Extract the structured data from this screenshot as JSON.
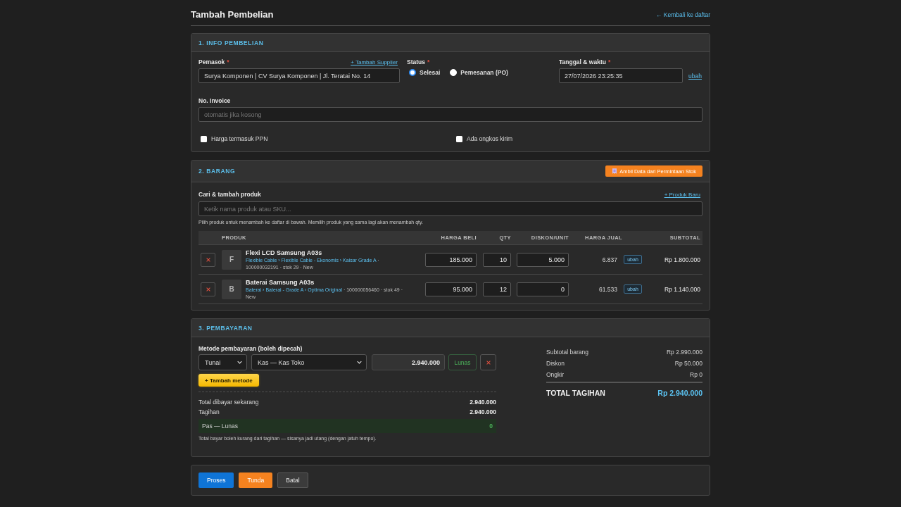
{
  "page": {
    "title": "Tambah Pembelian",
    "back_link": "← Kembali ke daftar"
  },
  "info_section": {
    "heading": "1. INFO PEMBELIAN",
    "supplier": {
      "label": "Pemasok",
      "required_mark": "*",
      "add_link": "+ Tambah Supplier",
      "value": "Surya Komponen | CV Surya Komponen | Jl. Teratai No. 14"
    },
    "status": {
      "label": "Status",
      "required_mark": "*",
      "options": [
        {
          "label": "Selesai",
          "selected": true
        },
        {
          "label": "Pemesanan (PO)",
          "selected": false
        }
      ]
    },
    "datetime": {
      "label": "Tanggal & waktu",
      "required_mark": "*",
      "value": "27/07/2026 23:25:35",
      "edit_link": "ubah"
    },
    "invoice": {
      "label": "No. Invoice",
      "placeholder": "otomatis jika kosong"
    },
    "checkboxes": [
      {
        "label": "Harga termasuk PPN",
        "checked": false
      },
      {
        "label": "Ada ongkos kirim",
        "checked": false
      }
    ]
  },
  "items_section": {
    "heading": "2. BARANG",
    "import_button": "Ambil Data dari Permintaan Stok",
    "search_label": "Cari & tambah produk",
    "new_product_link": "+ Produk Baru",
    "search": {
      "placeholder": "Ketik nama produk atau SKU..."
    },
    "hint": "Pilih produk untuk menambah ke daftar di bawah. Memilih produk yang sama lagi akan menambah qty.",
    "table": {
      "columns": [
        "PRODUK",
        "HARGA BELI",
        "QTY",
        "DISKON/UNIT",
        "HARGA JUAL",
        "SUBTOTAL"
      ],
      "rows": [
        {
          "initial": "F",
          "name": "Flexi LCD Samsung A03s",
          "category": "Flexible Cable › Flexible Cable - Ekonomis › Kaisar Grade A",
          "details": "· 100000032191 · stok 29 · New",
          "buy_price": "185.000",
          "qty": "10",
          "discount": "5.000",
          "sell_price": "6.837",
          "edit": "ubah",
          "subtotal": "Rp 1.800.000"
        },
        {
          "initial": "B",
          "name": "Baterai Samsung A03s",
          "category": "Baterai › Baterai - Grade A › Optima Original",
          "details": "· 100000056460 · stok 49 · New",
          "buy_price": "95.000",
          "qty": "12",
          "discount": "0",
          "sell_price": "61.533",
          "edit": "ubah",
          "subtotal": "Rp 1.140.000"
        }
      ]
    }
  },
  "payment_section": {
    "heading": "3. PEMBAYARAN",
    "methods_label": "Metode pembayaran (boleh dipecah)",
    "methods": [
      {
        "type": "Tunai",
        "account": "Kas — Kas Toko",
        "amount": "2.940.000",
        "pay_full": "Lunas"
      }
    ],
    "add_method": "+ Tambah metode",
    "totals": [
      {
        "label": "Total dibayar sekarang",
        "value": "2.940.000"
      },
      {
        "label": "Tagihan",
        "value": "2.940.000"
      }
    ],
    "balance": {
      "label": "Pas — Lunas",
      "value": "0",
      "settled": true
    },
    "note": "Total bayar boleh kurang dari tagihan — sisanya jadi utang (dengan jatuh tempo).",
    "summary": [
      {
        "label": "Subtotal barang",
        "value": "Rp 2.990.000"
      },
      {
        "label": "Diskon",
        "value": "Rp 50.000"
      },
      {
        "label": "Ongkir",
        "value": "Rp 0"
      }
    ],
    "grand_total": {
      "label": "TOTAL TAGIHAN",
      "value": "Rp 2.940.000"
    }
  },
  "actions": [
    {
      "label": "Proses",
      "kind": "primary"
    },
    {
      "label": "Tunda",
      "kind": "warning"
    },
    {
      "label": "Batal",
      "kind": "secondary"
    }
  ]
}
